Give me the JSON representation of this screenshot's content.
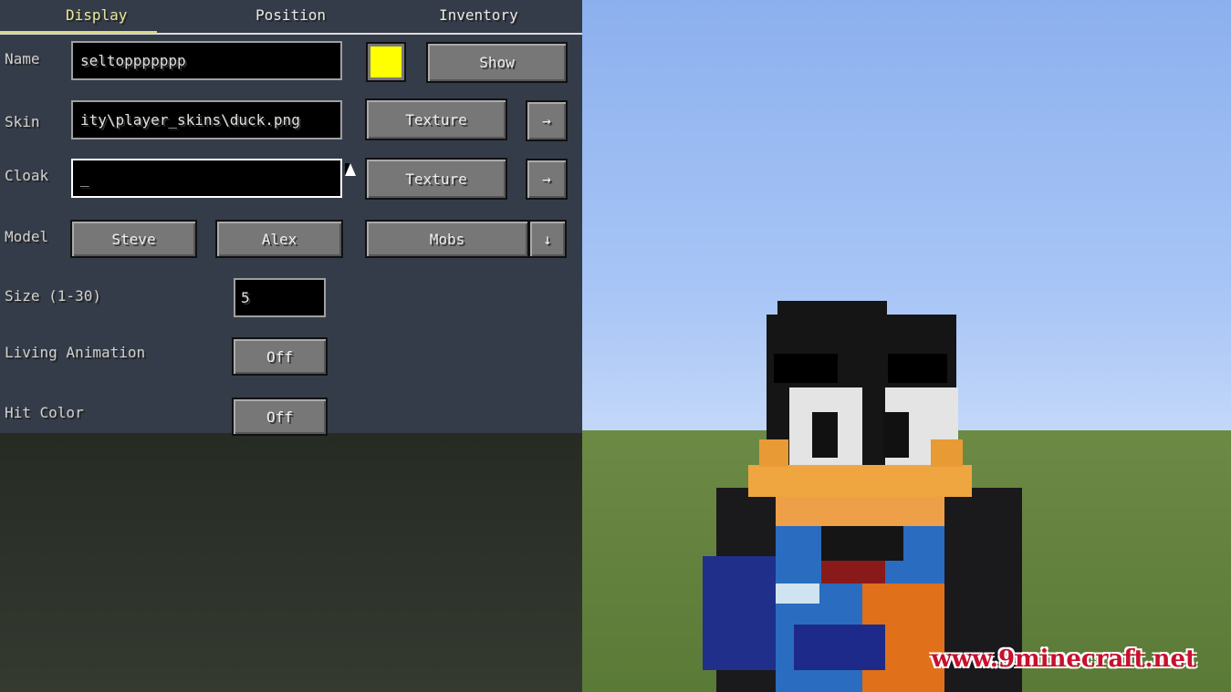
{
  "tabs": [
    {
      "label": "Display",
      "active": true
    },
    {
      "label": "Position"
    },
    {
      "label": "Inventory"
    }
  ],
  "name": {
    "label": "Name",
    "value": "seltoppppppp",
    "color": "#ffff00",
    "show_label": "Show"
  },
  "skin": {
    "label": "Skin",
    "value": "ity\\player_skins\\duck.png",
    "texture_label": "Texture",
    "arrow": "→"
  },
  "cloak": {
    "label": "Cloak",
    "value": "_",
    "texture_label": "Texture",
    "arrow": "→"
  },
  "model": {
    "label": "Model",
    "options": [
      "Steve",
      "Alex",
      "Mobs"
    ],
    "dropdown": "↓"
  },
  "size": {
    "label": "Size (1-30)",
    "value": "5"
  },
  "living_animation": {
    "label": "Living Animation",
    "value": "Off"
  },
  "hit_color": {
    "label": "Hit Color",
    "value": "Off"
  },
  "watermark": "www.9minecraft.net"
}
